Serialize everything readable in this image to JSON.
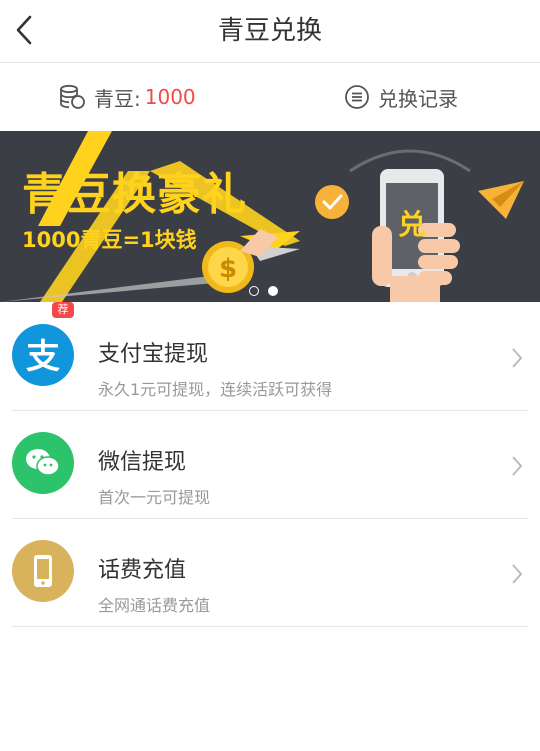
{
  "header": {
    "title": "青豆兑换"
  },
  "subbar": {
    "beans_label": "青豆:",
    "beans_count": "1000",
    "records_label": "兑换记录"
  },
  "banner": {
    "title": "青豆换豪礼",
    "subtitle": "1000青豆=1块钱",
    "phone_char": "兑",
    "pager": {
      "total": 2,
      "active": 2
    }
  },
  "colors": {
    "accent_red": "#f24a4a",
    "banner_bg": "#3b3e45",
    "banner_yellow": "#ffd21e",
    "alipay": "#1296db",
    "wechat": "#2dc36a",
    "phone": "#d8b35c"
  },
  "options": [
    {
      "title": "支付宝提现",
      "subtitle": "永久1元可提现，连续活跃可获得",
      "badge": "荐",
      "icon": "alipay-icon"
    },
    {
      "title": "微信提现",
      "subtitle": "首次一元可提现",
      "icon": "wechat-icon"
    },
    {
      "title": "话费充值",
      "subtitle": "全网通话费充值",
      "icon": "mobile-phone-icon"
    }
  ]
}
